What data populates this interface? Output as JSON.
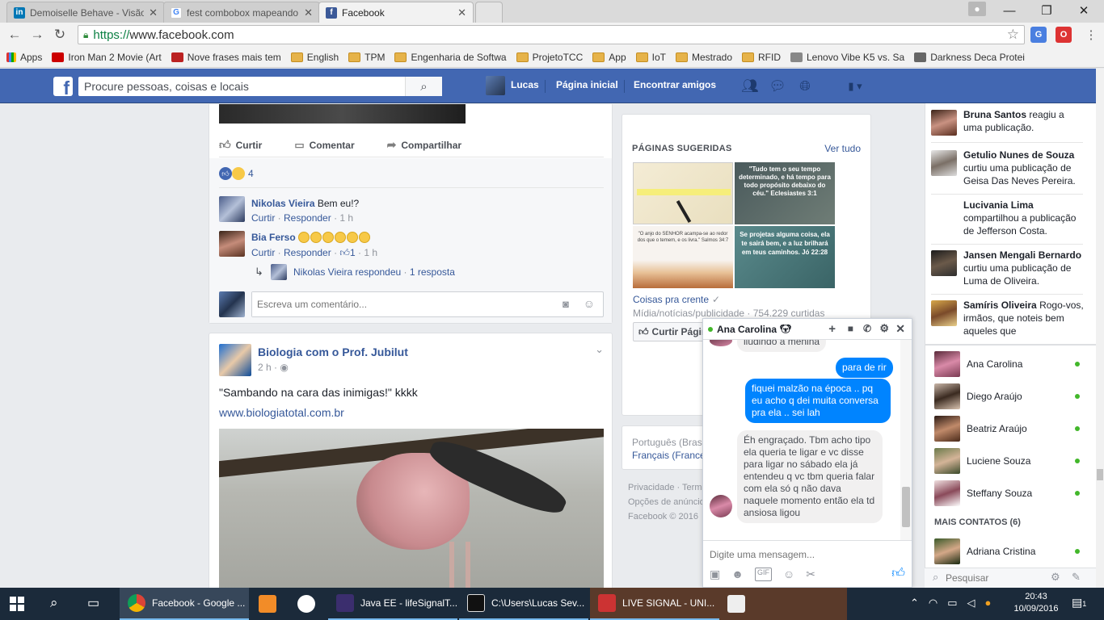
{
  "browser": {
    "tabs": [
      {
        "label": "Demoiselle Behave - Visão",
        "icon": "linkedin-icon",
        "active": false
      },
      {
        "label": "fest combobox mapeando",
        "icon": "google-icon",
        "active": false
      },
      {
        "label": "Facebook",
        "icon": "facebook-icon",
        "active": true
      }
    ],
    "url_scheme": "https://",
    "url_host": "www.facebook.com",
    "bookmarks": [
      "Apps",
      "Iron Man 2 Movie (Art",
      "Nove frases mais tem",
      "English",
      "TPM",
      "Engenharia de Softwa",
      "ProjetoTCC",
      "App",
      "IoT",
      "Mestrado",
      "RFID",
      "Lenovo Vibe K5 vs. Sa",
      "Darkness Deca Protei"
    ]
  },
  "fb": {
    "logo": "f",
    "search_placeholder": "Procure pessoas, coisas e locais",
    "user": "Lucas",
    "nav_home": "Página inicial",
    "nav_friends": "Encontrar amigos"
  },
  "post1": {
    "like": "Curtir",
    "comment": "Comentar",
    "share": "Compartilhar",
    "reactions_count": "4",
    "comments": [
      {
        "author": "Nikolas Vieira",
        "text": "Bem eu!?",
        "meta_like": "Curtir",
        "meta_reply": "Responder",
        "time": "1 h",
        "likes": ""
      },
      {
        "author": "Bia Ferso",
        "text": "",
        "meta_like": "Curtir",
        "meta_reply": "Responder",
        "time": "1 h",
        "likes": "1"
      }
    ],
    "reply_author": "Nikolas Vieira respondeu",
    "reply_count": "1 resposta",
    "comment_placeholder": "Escreva um comentário..."
  },
  "post2": {
    "page": "Biologia com o Prof. Jubilut",
    "time": "2 h",
    "text": "\"Sambando na cara das inimigas!\" kkkk",
    "link": "www.biologiatotal.com.br"
  },
  "suggested": {
    "title": "PÁGINAS SUGERIDAS",
    "see_all": "Ver tudo",
    "tiles": [
      "",
      "\"Tudo tem o seu tempo determinado, e há tempo para todo propósito debaixo do céu.\" Eclesiastes 3:1",
      "\"O anjo do SENHOR acampa-se ao redor dos que o temem, e os livra.\" Salmos 34:7",
      "Se projetas alguma coisa, ela te sairá bem, e a luz brilhará em teus caminhos. Jó 22:28"
    ],
    "page_name": "Coisas pra crente",
    "page_meta": "Mídia/notícias/publicidade · 754.229 curtidas",
    "like_btn": "Curtir Página"
  },
  "footer": {
    "langs1": "Português (Brasil)",
    "langs2": "Français (France)",
    "links1": "Privacidade · Termos",
    "links2": "Opções de anúncios",
    "copyright": "Facebook © 2016"
  },
  "ticker": [
    {
      "name": "Bruna Santos",
      "text": " reagiu a uma publicação."
    },
    {
      "name": "Getulio Nunes de Souza",
      "text": " curtiu uma publicação de Geisa Das Neves Pereira."
    },
    {
      "name": "Lucivania Lima",
      "text": " compartilhou a publicação de Jefferson Costa."
    },
    {
      "name": "Jansen Mengali Bernardo",
      "text": " curtiu uma publicação de Luma de Oliveira."
    },
    {
      "name": "Samíris Oliveira",
      "text": " Rogo-vos, irmãos, que noteis bem aqueles que"
    }
  ],
  "contacts": [
    "Ana Carolina",
    "Diego Araújo",
    "Beatriz Araújo",
    "Luciene Souza",
    "Steffany Souza"
  ],
  "more_contacts_label": "MAIS CONTATOS (6)",
  "more_contacts": [
    "Adriana Cristina"
  ],
  "chat_search_placeholder": "Pesquisar",
  "chat": {
    "name": "Ana Carolina",
    "partial": "iludindo a menina",
    "msg_me1": "para de rir",
    "msg_me2": "fiquei malzão na época .. pq eu acho q dei muita conversa pra ela .. sei lah",
    "msg_them": "Éh engraçado. Tbm acho tipo ela queria te ligar e vc disse para ligar no sábado ela já entendeu q vc tbm queria falar com ela só q não dava naquele momento então ela td ansiosa ligou",
    "input_placeholder": "Digite uma mensagem..."
  },
  "taskbar": {
    "items": [
      "Facebook - Google ...",
      "Java EE - lifeSignalT...",
      "C:\\Users\\Lucas Sev...",
      "LIVE SIGNAL - UNI..."
    ],
    "time": "20:43",
    "date": "10/09/2016",
    "notif": "1"
  },
  "colors": {
    "fb_blue": "#4267b2",
    "link": "#365899",
    "messenger": "#0084ff",
    "online": "#42b72a"
  }
}
